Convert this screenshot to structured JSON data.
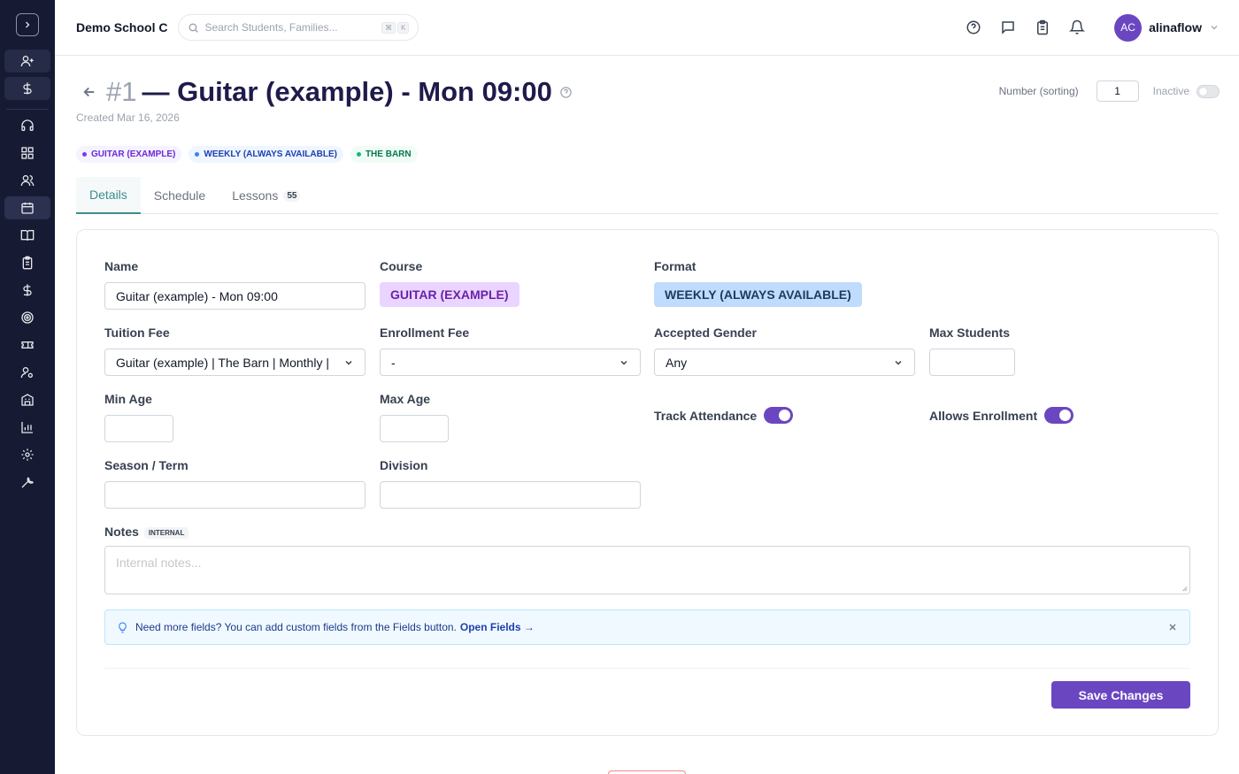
{
  "topbar": {
    "school": "Demo School C",
    "search_placeholder": "Search Students, Families...",
    "kbd1": "⌘",
    "kbd2": "K",
    "user_initials": "AC",
    "user_name": "alinaflow"
  },
  "header": {
    "number": "#1",
    "title": "— Guitar (example) - Mon 09:00",
    "created": "Created Mar 16, 2026",
    "sort_label": "Number (sorting)",
    "sort_value": "1",
    "inactive_label": "Inactive"
  },
  "tags": [
    "GUITAR (EXAMPLE)",
    "WEEKLY (ALWAYS AVAILABLE)",
    "THE BARN"
  ],
  "tabs": {
    "details": "Details",
    "schedule": "Schedule",
    "lessons": "Lessons",
    "lessons_count": "55"
  },
  "form": {
    "name_label": "Name",
    "name_value": "Guitar (example) - Mon 09:00",
    "course_label": "Course",
    "course_value": "GUITAR (EXAMPLE)",
    "format_label": "Format",
    "format_value": "WEEKLY (ALWAYS AVAILABLE)",
    "tuition_label": "Tuition Fee",
    "tuition_value": "Guitar (example) | The Barn | Monthly |",
    "enrollment_label": "Enrollment Fee",
    "enrollment_value": "-",
    "gender_label": "Accepted Gender",
    "gender_value": "Any",
    "max_students_label": "Max Students",
    "min_age_label": "Min Age",
    "max_age_label": "Max Age",
    "track_label": "Track Attendance",
    "allows_label": "Allows Enrollment",
    "season_label": "Season / Term",
    "division_label": "Division",
    "notes_label": "Notes",
    "notes_badge": "INTERNAL",
    "notes_placeholder": "Internal notes..."
  },
  "info": {
    "text": "Need more fields? You can add custom fields from the Fields button.",
    "link": "Open Fields →"
  },
  "save_label": "Save Changes"
}
